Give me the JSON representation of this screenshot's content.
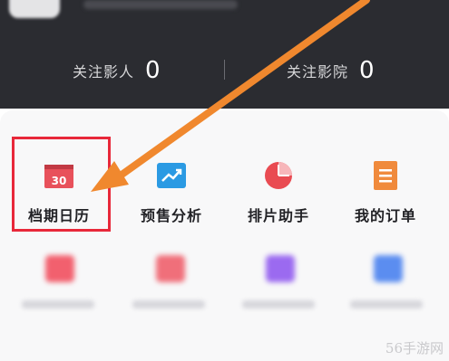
{
  "header": {
    "stats": [
      {
        "label": "关注影人",
        "count": "0"
      },
      {
        "label": "关注影院",
        "count": "0"
      }
    ]
  },
  "menu": {
    "items": [
      {
        "label": "档期日历",
        "icon": "calendar-icon",
        "icon_text": "30",
        "color": "#e8515b"
      },
      {
        "label": "预售分析",
        "icon": "trend-chart-icon",
        "color": "#2b9ae3"
      },
      {
        "label": "排片助手",
        "icon": "pie-chart-icon",
        "color": "#e94b52"
      },
      {
        "label": "我的订单",
        "icon": "order-list-icon",
        "color": "#f08a3c"
      }
    ],
    "blurred_items": [
      {
        "icon": "blurred-icon",
        "color": "#f2606e"
      },
      {
        "icon": "blurred-icon",
        "color": "#f06f7a"
      },
      {
        "icon": "blurred-icon",
        "color": "#9b6af0"
      },
      {
        "icon": "blurred-icon",
        "color": "#5b8df0"
      }
    ]
  },
  "watermark": "56手游网",
  "colors": {
    "header_bg": "#2b2c31",
    "highlight": "#e8283a",
    "arrow": "#f0882e"
  }
}
